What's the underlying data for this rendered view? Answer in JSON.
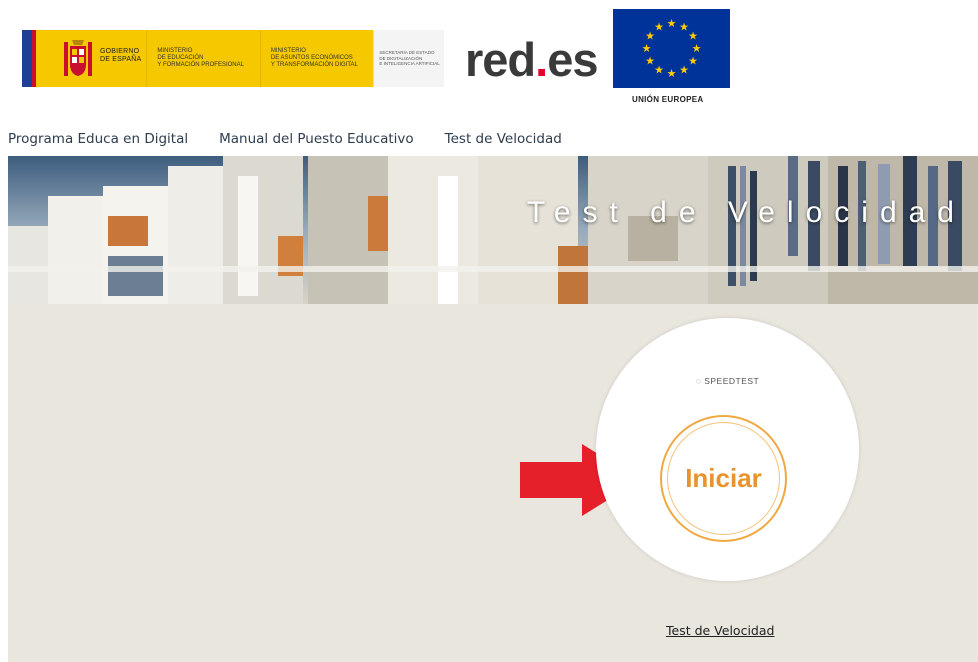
{
  "header": {
    "gov_text_line1": "GOBIERNO",
    "gov_text_line2": "DE ESPAÑA",
    "ministry1_line1": "MINISTERIO",
    "ministry1_line2": "DE EDUCACIÓN",
    "ministry1_line3": "Y FORMACIÓN PROFESIONAL",
    "ministry2_line1": "MINISTERIO",
    "ministry2_line2": "DE ASUNTOS ECONÓMICOS",
    "ministry2_line3": "Y TRANSFORMACIÓN DIGITAL",
    "secretary_line1": "SECRETARÍA DE ESTADO",
    "secretary_line2": "DE DIGITALIZACIÓN",
    "secretary_line3": "E INTELIGENCIA ARTIFICIAL",
    "reds_prefix": "red",
    "reds_dot": ".",
    "reds_suffix": "es",
    "eu_label": "UNIÓN EUROPEA"
  },
  "nav": {
    "items": [
      {
        "label": "Programa Educa en Digital"
      },
      {
        "label": "Manual del Puesto Educativo"
      },
      {
        "label": "Test de Velocidad"
      }
    ]
  },
  "hero": {
    "title": "Test de Velocidad"
  },
  "speedtest": {
    "brand": "SPEEDTEST",
    "start_label": "Iniciar"
  },
  "footer": {
    "link_label": "Test de Velocidad"
  },
  "colors": {
    "gov_yellow": "#f6c800",
    "eu_blue": "#003399",
    "reds_red": "#e4002b",
    "button_orange": "#e8932d",
    "arrow_red": "#e5202a",
    "main_bg": "#e9e6de"
  }
}
